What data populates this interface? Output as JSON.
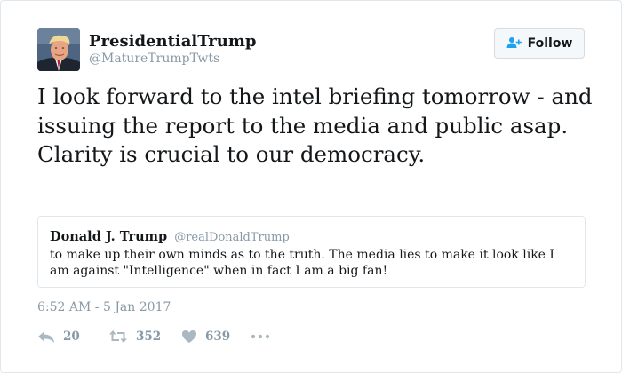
{
  "author": {
    "display_name": "PresidentialTrump",
    "handle": "@MatureTrumpTwts"
  },
  "follow_button": {
    "label": "Follow",
    "icon": "follow-user-plus-icon"
  },
  "tweet": {
    "text": "I look forward to the intel briefing tomorrow - and issuing the report to the media and public asap. Clarity is crucial to our democracy."
  },
  "quoted_tweet": {
    "display_name": "Donald J. Trump",
    "handle": "@realDonaldTrump",
    "text": "to make up their own minds as to the truth. The media lies to make it look like I am against \"Intelligence\" when in fact I am a big fan!"
  },
  "timestamp": "6:52 AM - 5 Jan 2017",
  "actions": {
    "reply": {
      "count": "20",
      "icon": "reply-icon"
    },
    "retweet": {
      "count": "352",
      "icon": "retweet-icon"
    },
    "like": {
      "count": "639",
      "icon": "heart-icon"
    },
    "more": {
      "icon": "more-dots-icon"
    }
  },
  "colors": {
    "text": "#14171a",
    "secondary_text": "#8899a6",
    "border": "#e1e8ed",
    "follow_accent": "#1da1f2",
    "icon_gray": "#aab8c2"
  }
}
